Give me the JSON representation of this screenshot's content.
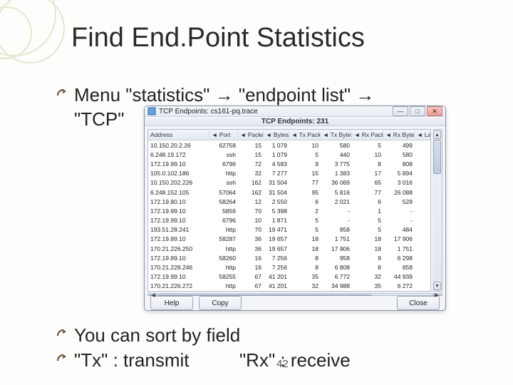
{
  "slide": {
    "title": "Find End.Point Statistics",
    "bullet1_pre": "Menu \"statistics\" ",
    "arrow": "→",
    "bullet1_mid": " \"endpoint list\" ",
    "bullet1_line2": "\"TCP\"",
    "bullet2": "You can sort by field",
    "bullet3_pre": "\"Tx\" : transmit",
    "bullet3_gap": "      ",
    "bullet3_post": "\"Rx\" : receive",
    "page_number": "42"
  },
  "window": {
    "title": "TCP Endpoints: cs161-pq.trace",
    "tab_label": "TCP Endpoints: 231",
    "columns": [
      "Address",
      "◄  Port",
      "◄ Packets",
      "◄ Bytes",
      "◄ Tx Packets",
      "◄ Tx Bytes",
      "◄ Rx Packets",
      "◄ Rx Bytes",
      "◄ Latitude ◄"
    ],
    "rows": [
      [
        "10.150.20.2.26",
        "62758",
        "15",
        "1 079",
        "10",
        "580",
        "5",
        "499",
        "-"
      ],
      [
        "6.248.19.172",
        "ssh",
        "15",
        "1 079",
        "5",
        "440",
        "10",
        "580",
        "-"
      ],
      [
        "172.19.99.10",
        "6796",
        "72",
        "4 583",
        "9",
        "3 775",
        "8",
        "808",
        "-"
      ],
      [
        "105.0.102.186",
        "http",
        "32",
        "7 277",
        "15",
        "1 383",
        "17",
        "5 894",
        "-"
      ],
      [
        "10.150.202.226",
        "ssh",
        "162",
        "31 504",
        "77",
        "36 069",
        "65",
        "3 016",
        "-"
      ],
      [
        "6.248.152.105",
        "57064",
        "162",
        "31 504",
        "95",
        "5 816",
        "77",
        "26 088",
        "-"
      ],
      [
        "172.19.80.10",
        "58264",
        "12",
        "2 550",
        "6",
        "2 021",
        "6",
        "528",
        "-"
      ],
      [
        "172.19.99.10",
        "5856",
        "70",
        "5 398",
        "2",
        "-",
        "1",
        "-",
        "-"
      ],
      [
        "172.19.99.10",
        "6796",
        "10",
        "1 871",
        "5",
        "-",
        "5",
        "-",
        "-"
      ],
      [
        "193.51.28.241",
        "http",
        "70",
        "19 471",
        "5",
        "858",
        "5",
        "484",
        "-"
      ],
      [
        "172.19.89.10",
        "58287",
        "36",
        "19 657",
        "18",
        "1 751",
        "18",
        "17 906",
        "-"
      ],
      [
        "170.21.226.250",
        "http",
        "36",
        "19 657",
        "18",
        "17 906",
        "18",
        "1 751",
        "-"
      ],
      [
        "172.19.89.10",
        "58260",
        "16",
        "7 256",
        "8",
        "958",
        "9",
        "6 298",
        "-"
      ],
      [
        "170.21.228.246",
        "http",
        "16",
        "7 256",
        "8",
        "6 808",
        "8",
        "858",
        "-"
      ],
      [
        "172.19.99.10",
        "58255",
        "67",
        "41 201",
        "35",
        "6 772",
        "32",
        "44 939",
        "-"
      ],
      [
        "170.21.226.272",
        "http",
        "67",
        "41 201",
        "32",
        "34 988",
        "35",
        "6 272",
        "-"
      ]
    ],
    "buttons": {
      "help": "Help",
      "copy": "Copy",
      "close": "Close"
    }
  }
}
